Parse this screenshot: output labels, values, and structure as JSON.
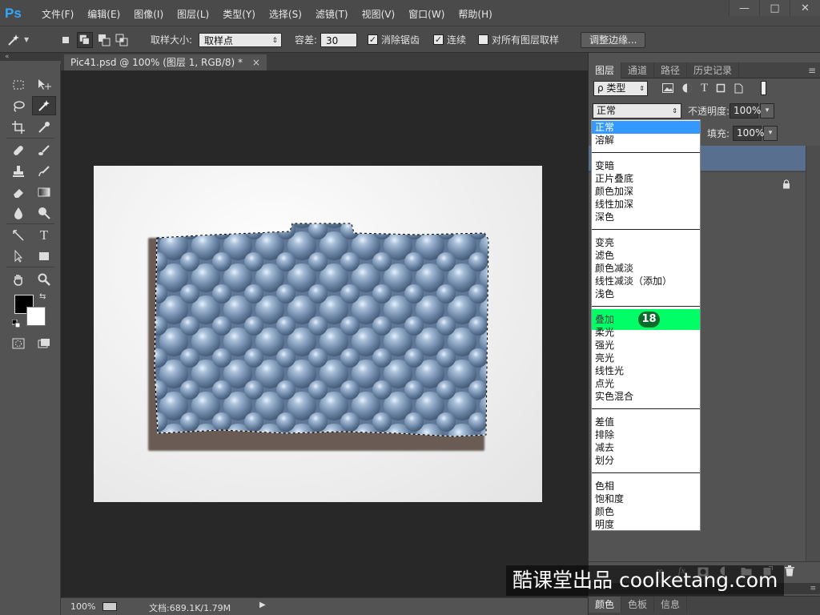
{
  "app": {
    "logo_text": "Ps",
    "menu": [
      "文件(F)",
      "编辑(E)",
      "图像(I)",
      "图层(L)",
      "类型(Y)",
      "选择(S)",
      "滤镜(T)",
      "视图(V)",
      "窗口(W)",
      "帮助(H)"
    ],
    "window_controls": [
      "—",
      "□",
      "✕"
    ]
  },
  "options": {
    "sample_size_label": "取样大小:",
    "sample_size_value": "取样点",
    "tolerance_label": "容差:",
    "tolerance_value": "30",
    "anti_alias_label": "消除锯齿",
    "anti_alias_checked": true,
    "contiguous_label": "连续",
    "contiguous_checked": true,
    "all_layers_label": "对所有图层取样",
    "all_layers_checked": false,
    "refine_edge_label": "调整边缘..."
  },
  "document": {
    "tab_title": "Pic41.psd @ 100% (图层 1, RGB/8) *",
    "tab_close": "×",
    "zoom": "100%",
    "doc_info": "文档:689.1K/1.79M"
  },
  "panels": {
    "tabs": [
      "图层",
      "通道",
      "路径",
      "历史记录"
    ],
    "filter_label": "ρ 类型",
    "filter_icons": [
      "image-icon",
      "adjustment-icon",
      "type-icon",
      "shape-icon",
      "smart-object-icon"
    ],
    "blend_mode_value": "正常",
    "opacity_label": "不透明度:",
    "opacity_value": "100%",
    "fill_label": "填充:",
    "fill_value": "100%",
    "bottom_tabs": [
      "颜色",
      "色板",
      "信息"
    ]
  },
  "blend_modes": {
    "groups": [
      [
        "正常",
        "溶解"
      ],
      [
        "变暗",
        "正片叠底",
        "颜色加深",
        "线性加深",
        "深色"
      ],
      [
        "变亮",
        "滤色",
        "颜色减淡",
        "线性减淡（添加）",
        "浅色"
      ],
      [
        "叠加",
        "柔光",
        "强光",
        "亮光",
        "线性光",
        "点光",
        "实色混合"
      ],
      [
        "差值",
        "排除",
        "减去",
        "划分"
      ],
      [
        "色相",
        "饱和度",
        "颜色",
        "明度"
      ]
    ],
    "selected": "正常",
    "highlighted": "叠加",
    "step_badge": "18"
  },
  "watermark": "酷课堂出品 coolketang.com",
  "colors": {
    "ps_blue": "#31a8ff",
    "selected_blue": "#3399ff",
    "highlight_green": "#00ff66",
    "badge_green": "#0d6b2e",
    "layer_selected": "#596f8f"
  }
}
